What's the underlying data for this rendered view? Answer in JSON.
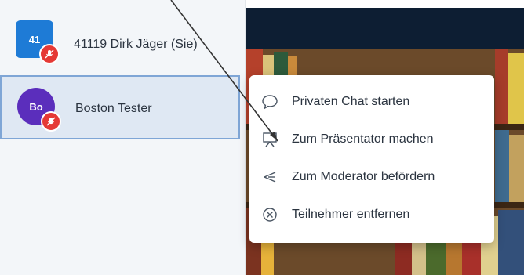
{
  "users": [
    {
      "initials": "41",
      "name": "41119 Dirk Jäger (Sie)",
      "avatar_color": "#1e7bd6",
      "mic_state": "muted"
    },
    {
      "initials": "Bo",
      "name": "Boston Tester",
      "avatar_color": "#5b2ebc",
      "mic_state": "muted"
    }
  ],
  "context_menu": {
    "items": [
      {
        "label": "Privaten Chat starten",
        "icon": "speech-bubble-icon"
      },
      {
        "label": "Zum Präsentator machen",
        "icon": "presenter-icon"
      },
      {
        "label": "Zum Moderator befördern",
        "icon": "promote-icon"
      },
      {
        "label": "Teilnehmer entfernen",
        "icon": "remove-circle-icon"
      }
    ]
  },
  "colors": {
    "sidebar_bg": "#f3f6f9",
    "selected_bg": "#dfe8f3",
    "selected_border": "#7fa6d6",
    "video_topbar": "#0d1e33",
    "mic_badge": "#e53935"
  }
}
